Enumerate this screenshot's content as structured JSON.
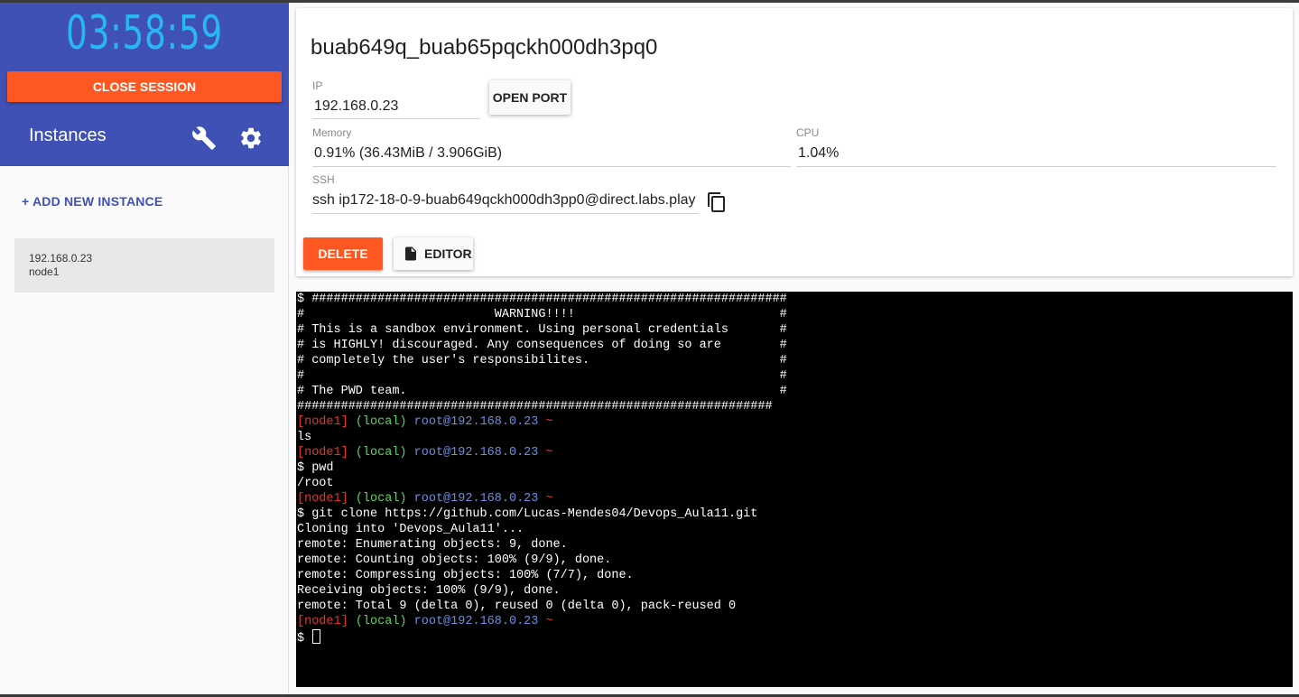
{
  "session": {
    "timer": "03:58:59",
    "close_label": "CLOSE SESSION",
    "timer_color": "#29b6f6",
    "close_color": "#ff5722",
    "header_color": "#3f51b5"
  },
  "sidebar": {
    "title": "Instances",
    "tools_icon": "wrench-icon",
    "settings_icon": "gear-icon",
    "add_label": "+ ADD NEW INSTANCE",
    "instances": [
      {
        "ip": "192.168.0.23",
        "name": "node1"
      }
    ]
  },
  "instance": {
    "hostname": "buab649q_buab65pqckh000dh3pq0",
    "ip_label": "IP",
    "ip": "192.168.0.23",
    "open_port_label": "OPEN PORT",
    "memory_label": "Memory",
    "memory": "0.91% (36.43MiB / 3.906GiB)",
    "cpu_label": "CPU",
    "cpu": "1.04%",
    "ssh_label": "SSH",
    "ssh": "ssh ip172-18-0-9-buab649qckh000dh3pp0@direct.labs.play",
    "copy_icon": "copy-icon",
    "delete_label": "DELETE",
    "editor_label": "EDITOR",
    "editor_icon": "file-icon"
  },
  "terminal": {
    "prompt_node": "[node1]",
    "prompt_env": "(local)",
    "prompt_user": "root@192.168.0.23",
    "prompt_tilde": "~",
    "colors": {
      "node": "#e8332c",
      "env": "#5fd35f",
      "user": "#6a8fe0"
    },
    "banner": [
      "$ #################################################################",
      "#                          WARNING!!!!                            #",
      "# This is a sandbox environment. Using personal credentials       #",
      "# is HIGHLY! discouraged. Any consequences of doing so are        #",
      "# completely the user's responsibilites.                          #",
      "#                                                                 #",
      "# The PWD team.                                                   #",
      "#################################################################"
    ],
    "blocks": [
      {
        "output": [
          "ls"
        ]
      },
      {
        "output": [
          "$ pwd",
          "/root"
        ]
      },
      {
        "output": [
          "$ git clone https://github.com/Lucas-Mendes04/Devops_Aula11.git",
          "Cloning into 'Devops_Aula11'...",
          "remote: Enumerating objects: 9, done.",
          "remote: Counting objects: 100% (9/9), done.",
          "remote: Compressing objects: 100% (7/7), done.",
          "Receiving objects: 100% (9/9), done.",
          "remote: Total 9 (delta 0), reused 0 (delta 0), pack-reused 0"
        ]
      }
    ],
    "final_prompt": "$ "
  }
}
